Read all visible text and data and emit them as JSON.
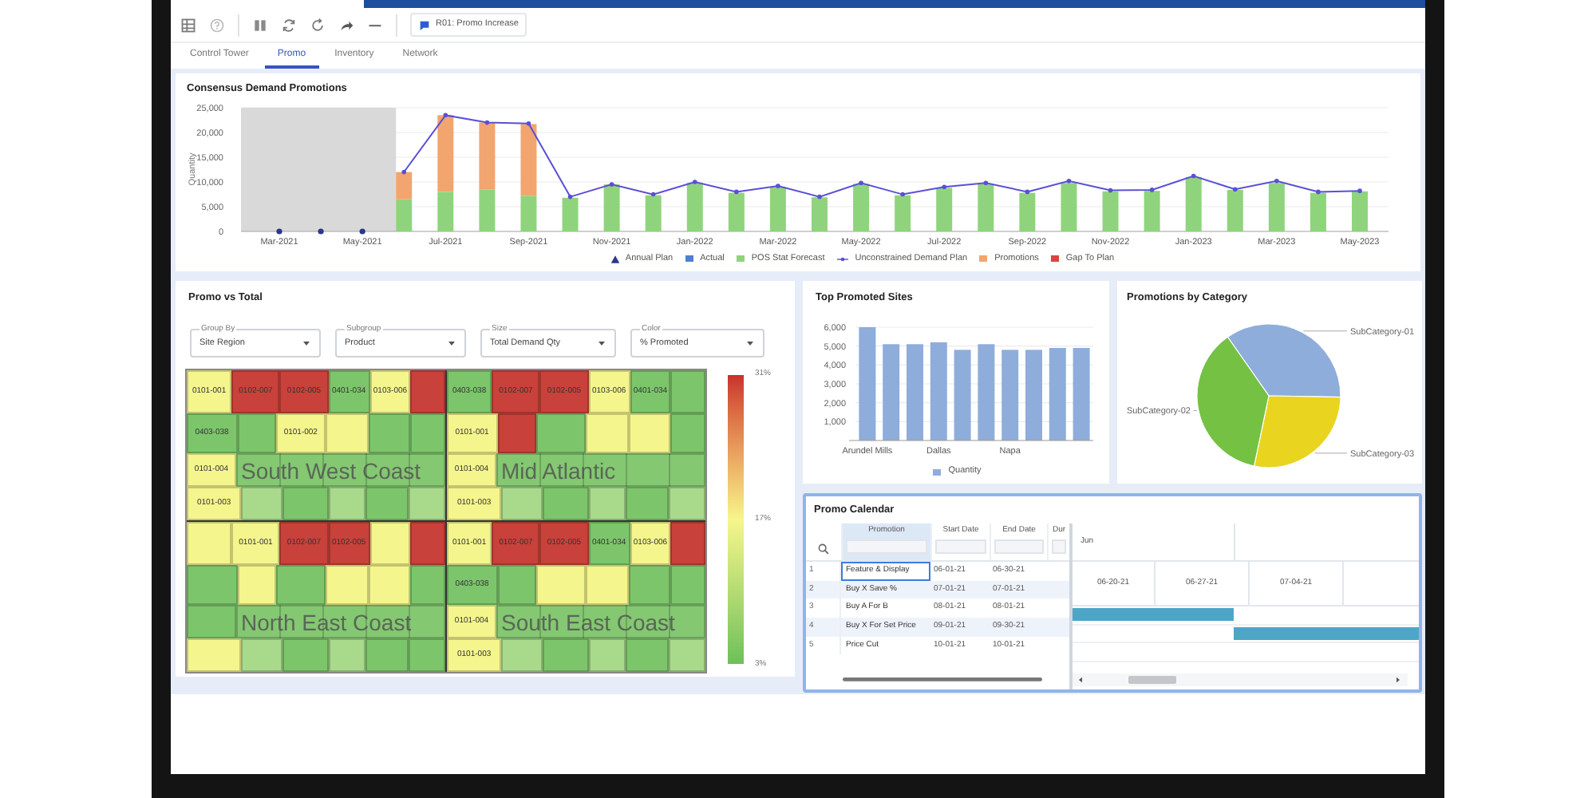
{
  "toolbar": {
    "scenario_button": "R01: Promo Increase"
  },
  "tabs": [
    {
      "label": "Control Tower",
      "selected": false
    },
    {
      "label": "Promo",
      "selected": true
    },
    {
      "label": "Inventory",
      "selected": false
    },
    {
      "label": "Network",
      "selected": false
    }
  ],
  "demand_chart": {
    "title": "Consensus Demand Promotions",
    "chart_data": {
      "type": "bar",
      "stacked": true,
      "grid": true,
      "legend": "bottom",
      "ylabel": "Quantity",
      "ylim": [
        0,
        25000
      ],
      "yticks": [
        {
          "value": 0,
          "label": "0"
        },
        {
          "value": 5000,
          "label": "5,000"
        },
        {
          "value": 10000,
          "label": "10,000"
        },
        {
          "value": 15000,
          "label": "15,000"
        },
        {
          "value": 20000,
          "label": "20,000"
        },
        {
          "value": 25000,
          "label": "25,000"
        }
      ],
      "categories": [
        "Mar-2021",
        null,
        "May-2021",
        null,
        "Jul-2021",
        null,
        "Sep-2021",
        null,
        "Nov-2021",
        null,
        "Jan-2022",
        null,
        "Mar-2022",
        null,
        "May-2022",
        null,
        "Jul-2022",
        null,
        "Sep-2022",
        null,
        "Nov-2022",
        null,
        "Jan-2023",
        null,
        "Mar-2023",
        null,
        "May-2023"
      ],
      "series": [
        {
          "name": "Annual Plan",
          "type": "scatter",
          "color": "#2b3788",
          "values": [
            0,
            0,
            0,
            null,
            null,
            null,
            null,
            null,
            null,
            null,
            null,
            null,
            null,
            null,
            null,
            null,
            null,
            null,
            null,
            null,
            null,
            null,
            null,
            null,
            null,
            null,
            null
          ]
        },
        {
          "name": "Actual",
          "type": "bar",
          "color": "#4f7fd1",
          "values": [
            null,
            null,
            null,
            null,
            null,
            null,
            null,
            null,
            null,
            null,
            null,
            null,
            null,
            null,
            null,
            null,
            null,
            null,
            null,
            null,
            null,
            null,
            null,
            null,
            null,
            null,
            null
          ]
        },
        {
          "name": "POS Stat Forecast",
          "type": "bar",
          "color": "#8fd47c",
          "values": [
            null,
            null,
            null,
            6500,
            8000,
            8500,
            7200,
            6800,
            9500,
            7300,
            9800,
            7800,
            9000,
            6900,
            9600,
            7300,
            8800,
            9600,
            7800,
            9800,
            8100,
            8200,
            11000,
            8400,
            9800,
            7800,
            8100
          ]
        },
        {
          "name": "Unconstrained Demand Plan",
          "type": "line",
          "color": "#5a4fd6",
          "values": [
            null,
            null,
            null,
            12000,
            23500,
            22000,
            21800,
            7000,
            9500,
            7500,
            10000,
            8000,
            9200,
            7000,
            9800,
            7500,
            9000,
            9800,
            8000,
            10200,
            8300,
            8400,
            11200,
            8500,
            10200,
            8000,
            8200
          ]
        },
        {
          "name": "Promotions",
          "type": "bar",
          "color": "#f2a56e",
          "values": [
            null,
            null,
            null,
            5500,
            15500,
            13500,
            14500,
            null,
            null,
            null,
            null,
            null,
            null,
            null,
            null,
            null,
            null,
            null,
            null,
            null,
            null,
            null,
            null,
            null,
            null,
            null,
            null
          ]
        },
        {
          "name": "Gap To Plan",
          "type": "bar",
          "color": "#d9443e",
          "values": [
            null,
            null,
            null,
            null,
            null,
            null,
            null,
            null,
            null,
            null,
            null,
            null,
            null,
            null,
            null,
            null,
            null,
            null,
            null,
            null,
            null,
            null,
            null,
            null,
            null,
            null,
            null
          ]
        }
      ]
    }
  },
  "promo_vs_total": {
    "title": "Promo vs Total",
    "dropdowns": [
      {
        "label": "Group By",
        "value": "Site Region"
      },
      {
        "label": "Subgroup",
        "value": "Product"
      },
      {
        "label": "Size",
        "value": "Total Demand Qty"
      },
      {
        "label": "Color",
        "value": "% Promoted"
      }
    ],
    "regions": [
      {
        "name": "South West Coast",
        "rows": [
          [
            {
              "label": "0101-001",
              "color": "#f4f58c"
            },
            {
              "label": "0102-007",
              "color": "#c8413a"
            },
            {
              "label": "0102-005",
              "color": "#c8413a"
            },
            {
              "label": "0401-034",
              "color": "#7cc56b"
            },
            {
              "label": "0103-006",
              "color": "#f4f58c"
            },
            {
              "color": "#c8413a"
            }
          ],
          [
            {
              "label": "0403-038",
              "color": "#7cc56b"
            },
            {
              "color": "#7cc56b"
            },
            {
              "label": "0101-002",
              "color": "#f4f58c"
            },
            {
              "color": "#f4f58c"
            },
            {
              "color": "#7cc56b"
            },
            {
              "color": "#7cc56b"
            }
          ],
          [
            {
              "label": "0101-004",
              "color": "#f4f58c"
            }
          ],
          [
            {
              "label": "0101-003",
              "color": "#f4f58c"
            },
            {
              "color": "#a9da8c"
            },
            {
              "color": "#7cc56b"
            },
            {
              "color": "#a9da8c"
            },
            {
              "color": "#7cc56b"
            },
            {
              "color": "#a9da8c"
            }
          ]
        ]
      },
      {
        "name": "Mid Atlantic",
        "rows": [
          [
            {
              "label": "0403-038",
              "color": "#7cc56b"
            },
            {
              "label": "0102-007",
              "color": "#c8413a"
            },
            {
              "label": "0102-005",
              "color": "#c8413a"
            },
            {
              "label": "0103-006",
              "color": "#f4f58c"
            },
            {
              "label": "0401-034",
              "color": "#7cc56b"
            },
            {
              "color": "#7cc56b"
            }
          ],
          [
            {
              "label": "0101-001",
              "color": "#f4f58c"
            },
            {
              "color": "#c8413a"
            },
            {
              "color": "#7cc56b"
            },
            {
              "color": "#f4f58c"
            },
            {
              "color": "#f4f58c"
            },
            {
              "color": "#7cc56b"
            }
          ],
          [
            {
              "label": "0101-004",
              "color": "#f4f58c"
            }
          ],
          [
            {
              "label": "0101-003",
              "color": "#f4f58c"
            },
            {
              "color": "#a9da8c"
            },
            {
              "color": "#7cc56b"
            },
            {
              "color": "#a9da8c"
            },
            {
              "color": "#7cc56b"
            },
            {
              "color": "#a9da8c"
            }
          ]
        ]
      },
      {
        "name": "North East Coast",
        "rows": [
          [
            {
              "color": "#f4f58c"
            },
            {
              "label": "0101-001",
              "color": "#f4f58c"
            },
            {
              "label": "0102-007",
              "color": "#c8413a"
            },
            {
              "label": "0102-005",
              "color": "#c8413a"
            },
            {
              "color": "#f4f58c"
            },
            {
              "color": "#c8413a"
            }
          ],
          [
            {
              "color": "#7cc56b"
            },
            {
              "color": "#f4f58c"
            },
            {
              "color": "#7cc56b"
            },
            {
              "color": "#f4f58c"
            },
            {
              "color": "#f4f58c"
            },
            {
              "color": "#7cc56b"
            }
          ],
          [
            {
              "color": "#7cc56b"
            }
          ],
          [
            {
              "color": "#f4f58c"
            },
            {
              "color": "#a9da8c"
            },
            {
              "color": "#7cc56b"
            },
            {
              "color": "#a9da8c"
            },
            {
              "color": "#7cc56b"
            },
            {
              "color": "#7cc56b"
            }
          ]
        ]
      },
      {
        "name": "South East Coast",
        "rows": [
          [
            {
              "label": "0101-001",
              "color": "#f4f58c"
            },
            {
              "label": "0102-007",
              "color": "#c8413a"
            },
            {
              "label": "0102-005",
              "color": "#c8413a"
            },
            {
              "label": "0401-034",
              "color": "#7cc56b"
            },
            {
              "label": "0103-006",
              "color": "#f4f58c"
            },
            {
              "color": "#c8413a"
            }
          ],
          [
            {
              "label": "0403-038",
              "color": "#7cc56b"
            },
            {
              "color": "#7cc56b"
            },
            {
              "color": "#f4f58c"
            },
            {
              "color": "#f4f58c"
            },
            {
              "color": "#7cc56b"
            },
            {
              "color": "#7cc56b"
            }
          ],
          [
            {
              "label": "0101-004",
              "color": "#f4f58c"
            }
          ],
          [
            {
              "label": "0101-003",
              "color": "#f4f58c"
            },
            {
              "color": "#a9da8c"
            },
            {
              "color": "#7cc56b"
            },
            {
              "color": "#a9da8c"
            },
            {
              "color": "#7cc56b"
            },
            {
              "color": "#a9da8c"
            }
          ]
        ]
      }
    ],
    "color_scale": {
      "max": "31%",
      "mid": "17%",
      "min": "3%"
    }
  },
  "top_sites": {
    "title": "Top Promoted Sites",
    "chart_data": {
      "type": "bar",
      "ylim": [
        0,
        6000
      ],
      "grid": true,
      "yticks": [
        {
          "value": 1000,
          "label": "1,000"
        },
        {
          "value": 2000,
          "label": "2,000"
        },
        {
          "value": 3000,
          "label": "3,000"
        },
        {
          "value": 4000,
          "label": "4,000"
        },
        {
          "value": 5000,
          "label": "5,000"
        },
        {
          "value": 6000,
          "label": "6,000"
        }
      ],
      "categories": [
        "Arundel Mills",
        null,
        null,
        "Dallas",
        null,
        null,
        "Napa",
        null,
        null,
        null
      ],
      "series": [
        {
          "name": "Quantity",
          "color": "#8eaddb",
          "values": [
            6000,
            5100,
            5100,
            5200,
            4800,
            5100,
            4800,
            4800,
            4900,
            4900
          ]
        }
      ]
    }
  },
  "category_pie": {
    "title": "Promotions by Category",
    "chart_data": {
      "type": "pie",
      "categories": [
        "SubCategory-01",
        "SubCategory-03",
        "SubCategory-02"
      ],
      "values": [
        35,
        28,
        37
      ],
      "colors": [
        "#8eaddb",
        "#e9d41f",
        "#74c144"
      ]
    }
  },
  "promo_calendar": {
    "title": "Promo Calendar",
    "columns": [
      "Promotion",
      "Start Date",
      "End Date",
      "Dur"
    ],
    "rows": [
      {
        "number": "1",
        "promotion": "Feature & Display",
        "start": "06-01-21",
        "end": "06-30-21",
        "selected": true,
        "kind": "bar_early"
      },
      {
        "number": "2",
        "promotion": "Buy X Save %",
        "start": "07-01-21",
        "end": "07-01-21",
        "selected": false,
        "kind": "bar_late"
      },
      {
        "number": "3",
        "promotion": "Buy A For B",
        "start": "08-01-21",
        "end": "08-01-21",
        "selected": false,
        "kind": "plain"
      },
      {
        "number": "4",
        "promotion": "Buy X For Set Price",
        "start": "09-01-21",
        "end": "09-30-21",
        "selected": false,
        "kind": "plain"
      },
      {
        "number": "5",
        "promotion": "Price Cut",
        "start": "10-01-21",
        "end": "10-01-21",
        "selected": false,
        "kind": "plain"
      }
    ],
    "gantt": {
      "month": "Jun",
      "weeks": [
        "06-20-21",
        "06-27-21",
        "07-04-21"
      ]
    }
  }
}
